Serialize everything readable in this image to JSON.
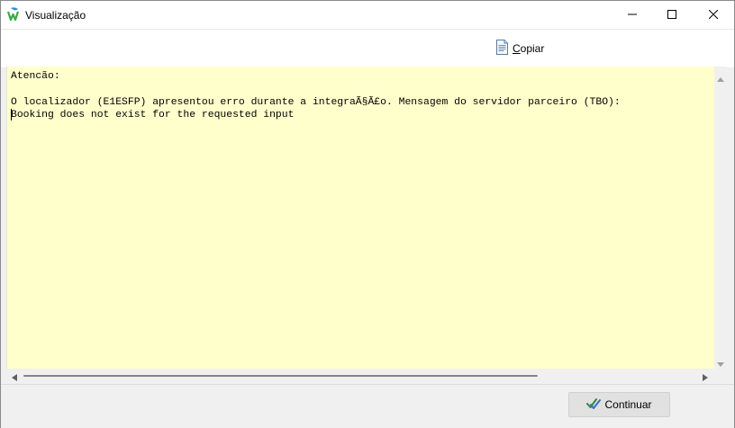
{
  "window": {
    "title": "Visualização",
    "icon": "app-logo-icon",
    "controls": {
      "minimize_icon": "minimize-icon",
      "maximize_icon": "maximize-icon",
      "close_icon": "close-icon"
    }
  },
  "toolbar": {
    "copy_label_underlined": "C",
    "copy_label_rest": "opiar",
    "copy_icon": "document-icon"
  },
  "content": {
    "background_color": "#ffffcc",
    "lines": [
      "Atencão:",
      "",
      "O localizador (E1ESFP) apresentou erro durante a integraÃ§Ã£o. Mensagem do servidor parceiro (TBO):",
      "Booking does not exist for the requested input"
    ]
  },
  "footer": {
    "continue_label": "Continuar",
    "continue_icon": "double-check-icon"
  }
}
